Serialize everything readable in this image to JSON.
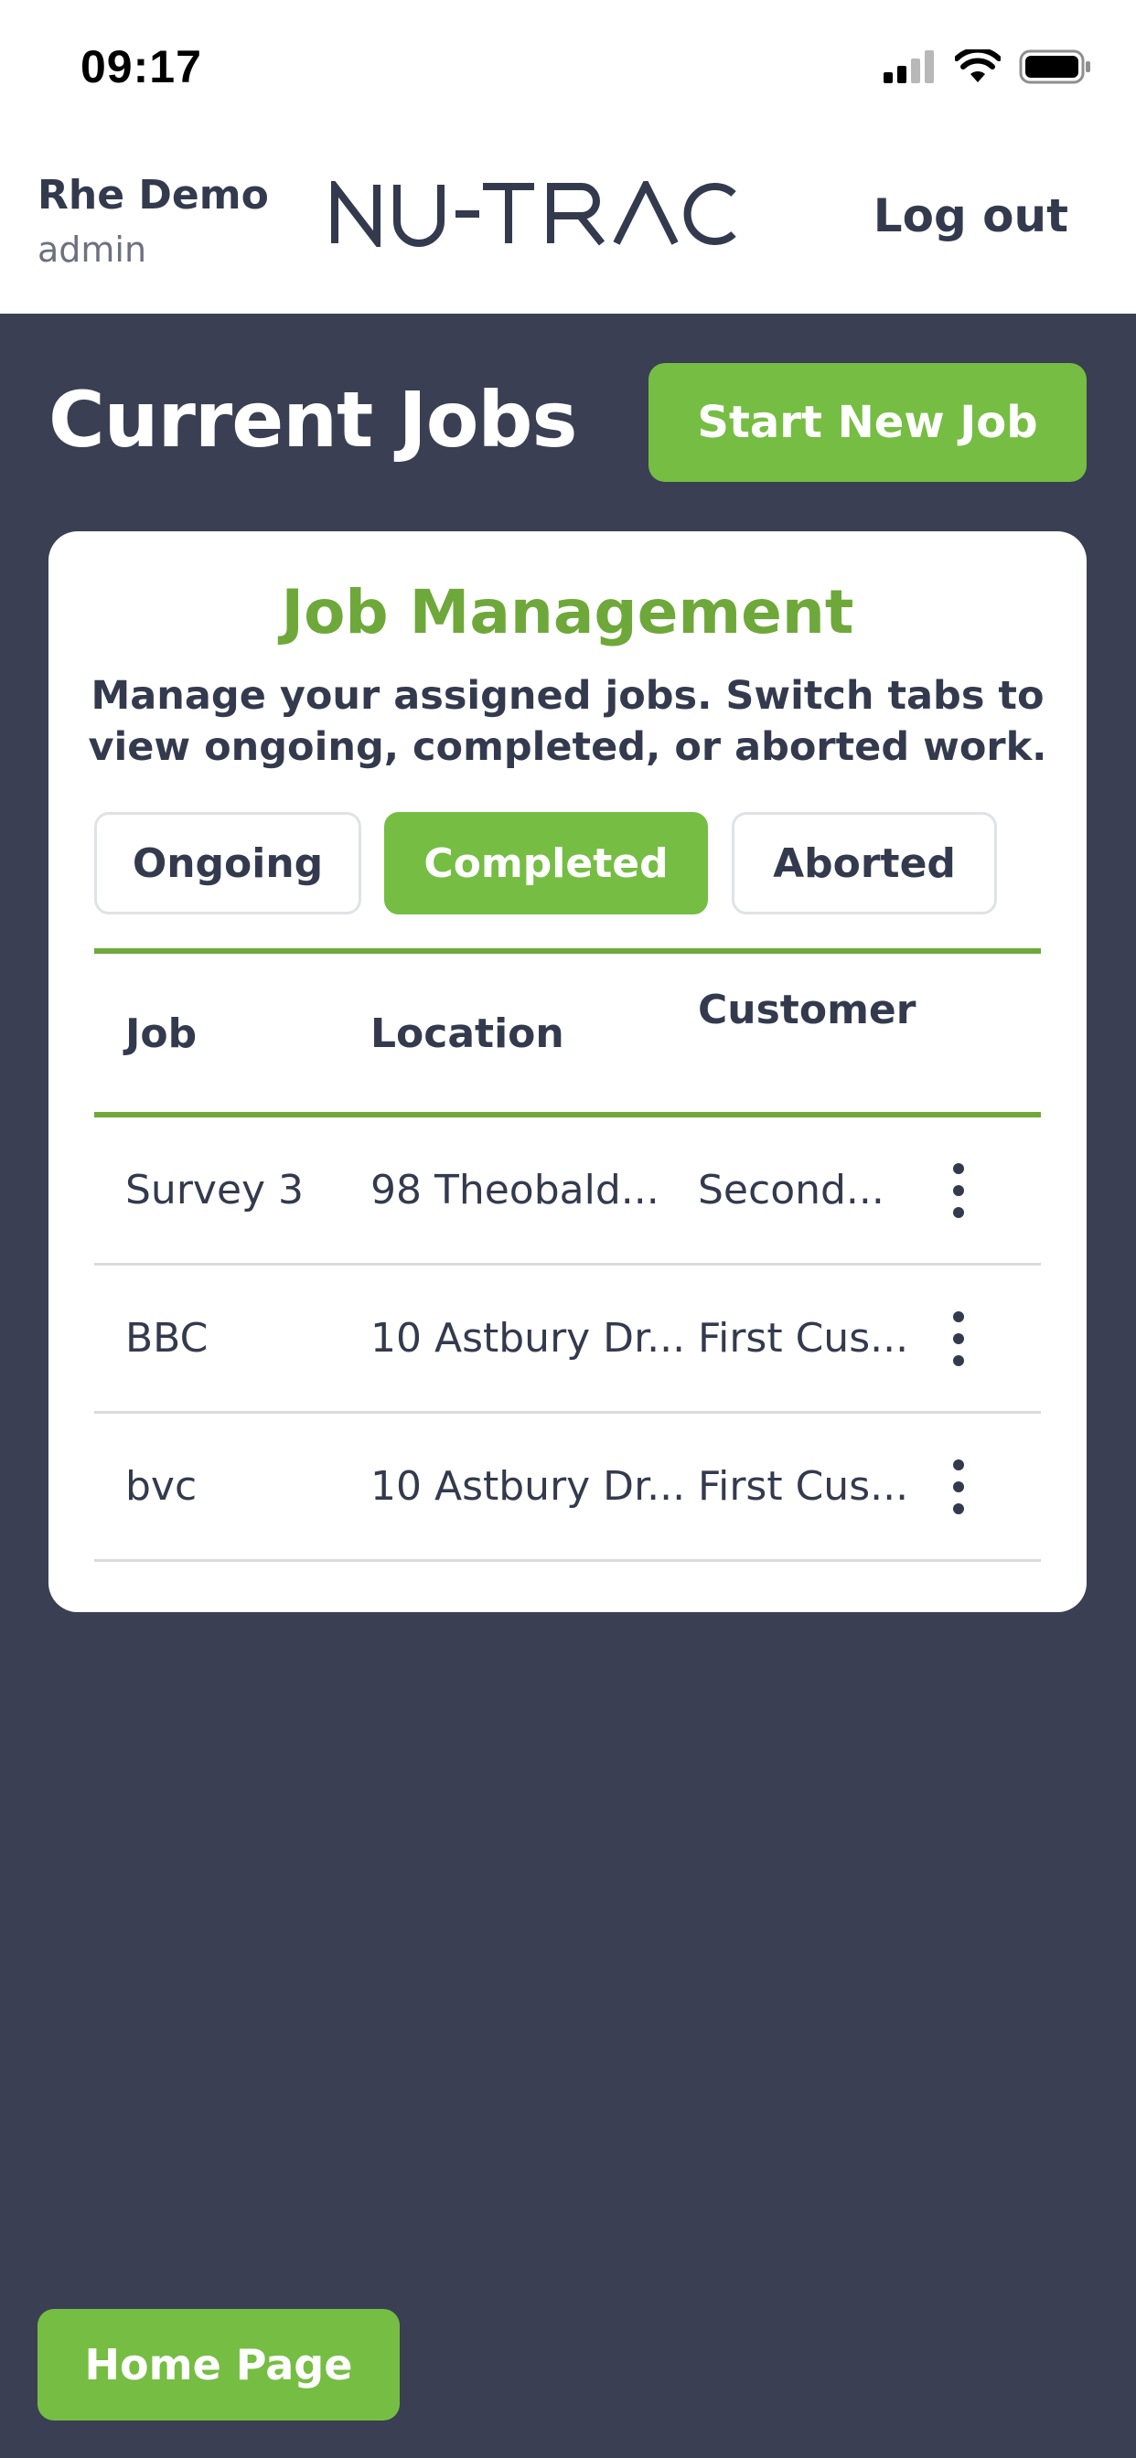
{
  "status_bar": {
    "time": "09:17"
  },
  "header": {
    "user_name": "Rhe Demo",
    "user_role": "admin",
    "logo_text": "NU-TRAC",
    "logout_label": "Log out"
  },
  "page": {
    "title": "Current Jobs",
    "start_new_job_label": "Start New Job"
  },
  "card": {
    "title": "Job Management",
    "description_line1": "Manage your assigned jobs. Switch tabs to",
    "description_line2": "view ongoing, completed, or aborted work.",
    "tabs": [
      {
        "label": "Ongoing",
        "active": false
      },
      {
        "label": "Completed",
        "active": true
      },
      {
        "label": "Aborted",
        "active": false
      }
    ],
    "table": {
      "columns": [
        "Job",
        "Location",
        "Customer"
      ],
      "rows": [
        {
          "job": "Survey 3",
          "location": "98 Theobald...",
          "customer": "Second..."
        },
        {
          "job": "BBC",
          "location": "10 Astbury Dr...",
          "customer": "First Cus..."
        },
        {
          "job": "bvc",
          "location": "10 Astbury Dr...",
          "customer": "First Cus..."
        }
      ]
    }
  },
  "footer": {
    "home_label": "Home Page"
  },
  "icons": {
    "signal": "cellular-signal-icon",
    "wifi": "wifi-icon",
    "battery": "battery-icon",
    "row_menu": "more-vertical-icon"
  },
  "colors": {
    "accent_green": "#76bd43",
    "title_green": "#6fa83a",
    "navy_background": "#3a3f53",
    "text_dark": "#343a4e"
  }
}
